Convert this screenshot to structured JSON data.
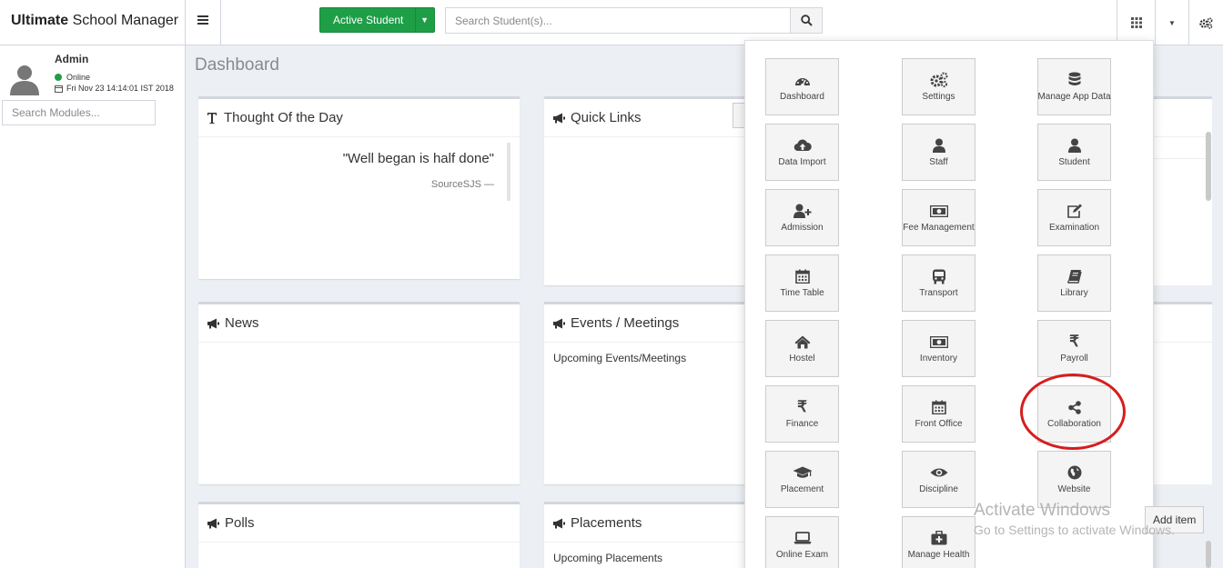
{
  "header": {
    "brand_bold": "Ultimate",
    "brand_rest": " School Manager",
    "active_student_label": "Active Student",
    "search_placeholder": "Search Student(s)..."
  },
  "sidebar": {
    "user_name": "Admin",
    "status": "Online",
    "datetime": "Fri Nov 23 14:14:01 IST 2018",
    "search_placeholder": "Search Modules..."
  },
  "main": {
    "page_title": "Dashboard",
    "boxes": {
      "thought": {
        "title": "Thought Of the Day",
        "quote": "\"Well began is half done\"",
        "source": "SourceSJS —"
      },
      "quick_links": {
        "title": "Quick Links"
      },
      "news": {
        "title": "News"
      },
      "events": {
        "title": "Events / Meetings",
        "body": "Upcoming Events/Meetings"
      },
      "polls": {
        "title": "Polls"
      },
      "placements": {
        "title": "Placements",
        "body": "Upcoming Placements"
      }
    },
    "add_item_label": "Add item"
  },
  "modules": [
    {
      "label": "Dashboard",
      "icon": "dashboard-icon"
    },
    {
      "label": "Settings",
      "icon": "cogs-icon"
    },
    {
      "label": "Manage App Data",
      "icon": "database-icon"
    },
    {
      "label": "Data Import",
      "icon": "cloud-upload-icon"
    },
    {
      "label": "Staff",
      "icon": "user-icon"
    },
    {
      "label": "Student",
      "icon": "user-icon"
    },
    {
      "label": "Admission",
      "icon": "user-plus-icon"
    },
    {
      "label": "Fee Management",
      "icon": "money-icon"
    },
    {
      "label": "Examination",
      "icon": "edit-icon"
    },
    {
      "label": "Time Table",
      "icon": "calendar-icon"
    },
    {
      "label": "Transport",
      "icon": "bus-icon"
    },
    {
      "label": "Library",
      "icon": "book-icon"
    },
    {
      "label": "Hostel",
      "icon": "home-icon"
    },
    {
      "label": "Inventory",
      "icon": "money-icon"
    },
    {
      "label": "Payroll",
      "icon": "rupee-icon"
    },
    {
      "label": "Finance",
      "icon": "rupee-icon"
    },
    {
      "label": "Front Office",
      "icon": "calendar-icon"
    },
    {
      "label": "Collaboration",
      "icon": "share-icon"
    },
    {
      "label": "Placement",
      "icon": "graduation-cap-icon"
    },
    {
      "label": "Discipline",
      "icon": "eye-icon"
    },
    {
      "label": "Website",
      "icon": "globe-icon"
    },
    {
      "label": "Online Exam",
      "icon": "laptop-icon"
    },
    {
      "label": "Manage Health",
      "icon": "medkit-icon"
    }
  ],
  "watermark": {
    "line1": "Activate Windows",
    "line2": "Go to Settings to activate Windows."
  },
  "colors": {
    "primary_green": "#1e9e47",
    "highlight_circle": "#d71d1d",
    "background": "#ecf0f5"
  }
}
